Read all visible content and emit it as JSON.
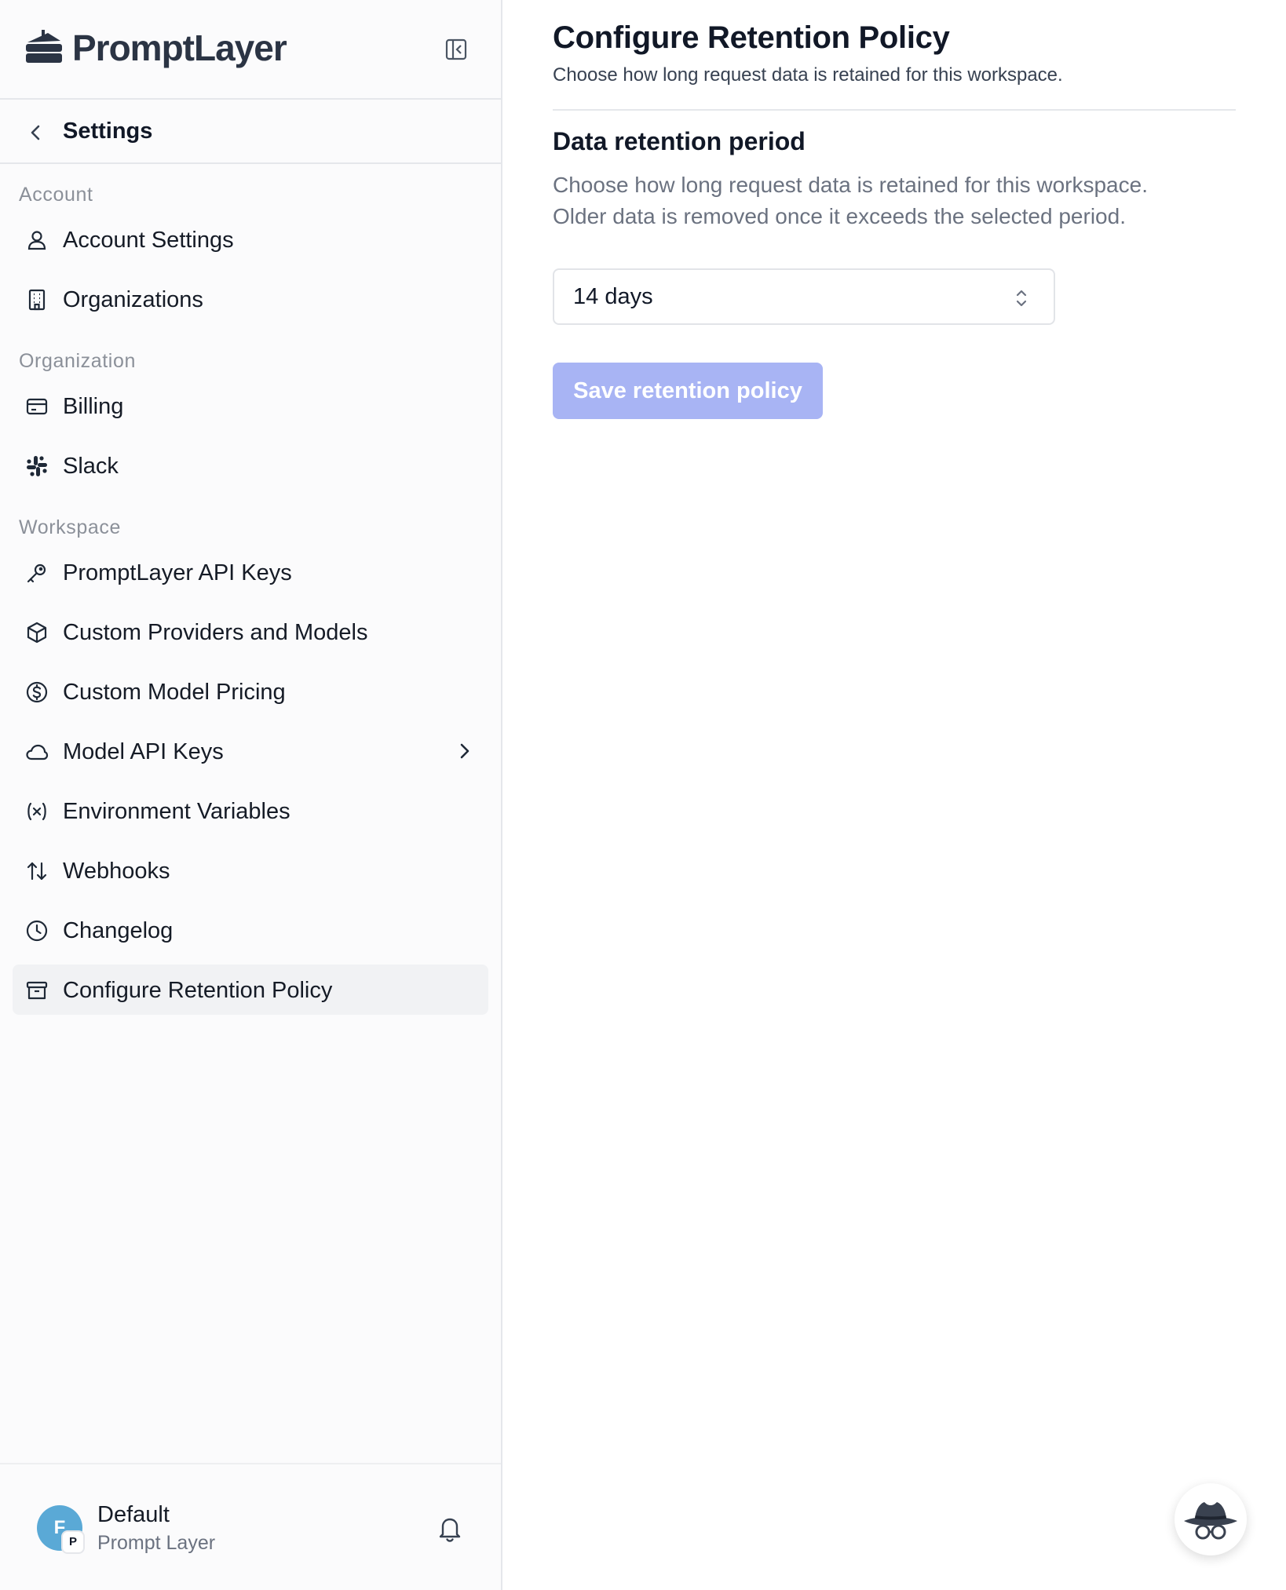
{
  "brand": {
    "name": "PromptLayer"
  },
  "nav_header": {
    "back_label": "Settings"
  },
  "sections": {
    "account": "Account",
    "organization": "Organization",
    "workspace": "Workspace"
  },
  "nav": {
    "account_settings": {
      "label": "Account Settings",
      "icon": "user-icon"
    },
    "organizations": {
      "label": "Organizations",
      "icon": "building-icon"
    },
    "billing": {
      "label": "Billing",
      "icon": "credit-card-icon"
    },
    "slack": {
      "label": "Slack",
      "icon": "slack-icon"
    },
    "api_keys": {
      "label": "PromptLayer API Keys",
      "icon": "key-icon"
    },
    "custom_providers": {
      "label": "Custom Providers and Models",
      "icon": "box-icon"
    },
    "custom_pricing": {
      "label": "Custom Model Pricing",
      "icon": "dollar-circle-icon"
    },
    "model_api_keys": {
      "label": "Model API Keys",
      "icon": "cloud-icon"
    },
    "env_vars": {
      "label": "Environment Variables",
      "icon": "variable-icon"
    },
    "webhooks": {
      "label": "Webhooks",
      "icon": "arrows-up-down-icon"
    },
    "changelog": {
      "label": "Changelog",
      "icon": "clock-icon"
    },
    "retention": {
      "label": "Configure Retention Policy",
      "icon": "archive-icon",
      "active": true
    }
  },
  "footer": {
    "avatar_initial": "F",
    "avatar_badge": "P",
    "workspace_name": "Default",
    "org_name": "Prompt Layer"
  },
  "main": {
    "title": "Configure Retention Policy",
    "subtitle": "Choose how long request data is retained for this workspace.",
    "section_title": "Data retention period",
    "section_desc_line1": "Choose how long request data is retained for this workspace.",
    "section_desc_line2": "Older data is removed once it exceeds the selected period.",
    "select_value": "14 days",
    "save_label": "Save retention policy"
  },
  "colors": {
    "accent_disabled": "#a8b4f4",
    "active_item_bg": "#f1f2f4",
    "avatar": "#5aa9d6"
  }
}
